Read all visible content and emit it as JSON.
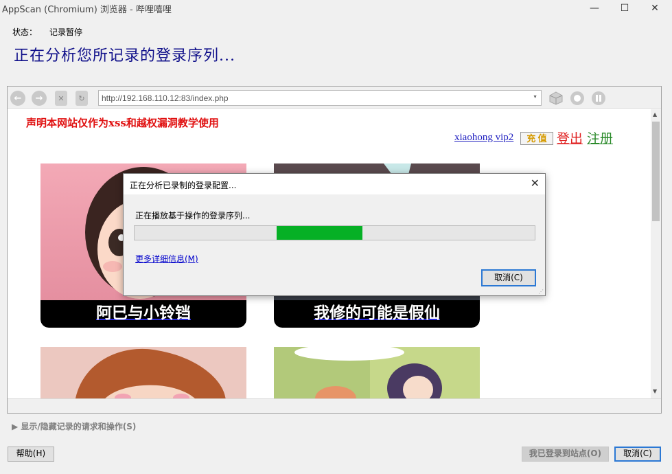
{
  "window": {
    "title": "AppScan (Chromium) 浏览器 - 哔哩嘻哩",
    "minimize_glyph": "—",
    "maximize_glyph": "☐",
    "close_glyph": "✕"
  },
  "status": {
    "label": "状态：",
    "value": "记录暂停"
  },
  "headline": "正在分析您所记录的登录序列...",
  "browser": {
    "url": "http://192.168.110.12:83/index.php",
    "page": {
      "notice": "声明本网站仅作为xss和越权漏洞教学使用",
      "username": "xiaohong vip2",
      "recharge": "充 值",
      "logout": "登出",
      "register": "注册",
      "cards": [
        {
          "title": "阿巳与小铃铛"
        },
        {
          "title": "我修的可能是假仙"
        }
      ]
    }
  },
  "dialog": {
    "title": "正在分析已录制的登录配置...",
    "message": "正在播放基于操作的登录序列...",
    "progress": {
      "start": 0.355,
      "end": 0.57
    },
    "more_link": "更多详细信息(M)",
    "cancel": "取消(C)"
  },
  "toggle_label": "显示/隐藏记录的请求和操作(S)",
  "buttons": {
    "help": "帮助(H)",
    "logged_in": "我已登录到站点(O)",
    "cancel": "取消(C)"
  },
  "colors": {
    "headline": "#10108a",
    "notice": "#e01010",
    "progress_fill": "#06b025",
    "focus_border": "#2b78d4"
  }
}
